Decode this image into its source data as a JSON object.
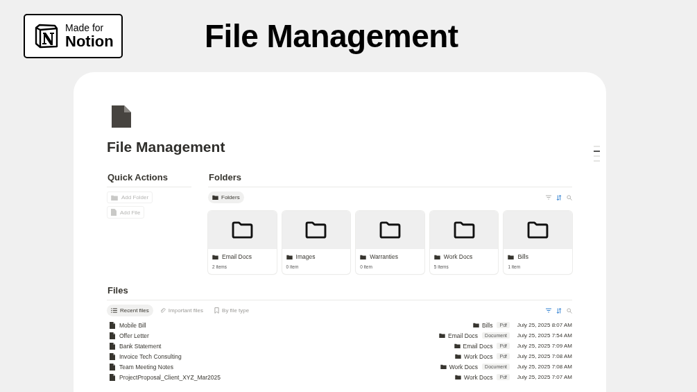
{
  "badge": {
    "line1": "Made for",
    "line2": "Notion"
  },
  "headline": "File Management",
  "page": {
    "title": "File Management"
  },
  "outline": [
    {
      "selected": false
    },
    {
      "selected": true
    },
    {
      "selected": false
    },
    {
      "selected": false
    }
  ],
  "quick_actions": {
    "heading": "Quick Actions",
    "buttons": [
      {
        "label": "Add Folder",
        "kind": "folder"
      },
      {
        "label": "Add File",
        "kind": "file"
      }
    ]
  },
  "folders": {
    "heading": "Folders",
    "view": {
      "label": "Folders",
      "selected": true
    },
    "toolbar": {
      "filter_active": false,
      "sort_active": true
    },
    "items": [
      {
        "name": "Email Docs",
        "count": "2 items"
      },
      {
        "name": "Images",
        "count": "0 item"
      },
      {
        "name": "Warranties",
        "count": "0 item"
      },
      {
        "name": "Work Docs",
        "count": "5 items"
      },
      {
        "name": "Bills",
        "count": "1 item"
      }
    ]
  },
  "files": {
    "heading": "Files",
    "toolbar": {
      "filter_active": true,
      "sort_active": true
    },
    "tabs": [
      {
        "label": "Recent files",
        "kind": "list",
        "selected": true
      },
      {
        "label": "Important files",
        "kind": "link",
        "selected": false
      },
      {
        "label": "By file type",
        "kind": "bookmark",
        "selected": false
      }
    ],
    "rows": [
      {
        "name": "Mobile Bill",
        "folder": "Bills",
        "type": "Pdf",
        "date": "July 25, 2025 8:07 AM"
      },
      {
        "name": "Offer Letter",
        "folder": "Email Docs",
        "type": "Document",
        "date": "July 25, 2025 7:54 AM"
      },
      {
        "name": "Bank Statement",
        "folder": "Email Docs",
        "type": "Pdf",
        "date": "July 25, 2025 7:09 AM"
      },
      {
        "name": "Invoice Tech Consulting",
        "folder": "Work Docs",
        "type": "Pdf",
        "date": "July 25, 2025 7:08 AM"
      },
      {
        "name": "Team Meeting Notes",
        "folder": "Work Docs",
        "type": "Document",
        "date": "July 25, 2025 7:08 AM"
      },
      {
        "name": "ProjectProposal_Client_XYZ_Mar2025",
        "folder": "Work Docs",
        "type": "Pdf",
        "date": "July 25, 2025 7:07 AM"
      }
    ]
  }
}
